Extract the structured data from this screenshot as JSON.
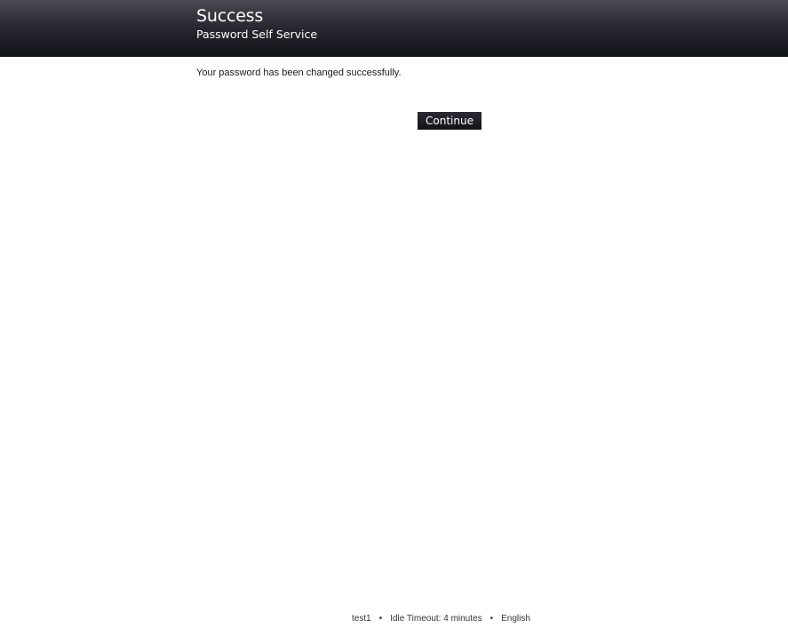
{
  "header": {
    "title": "Success",
    "subtitle": "Password Self Service"
  },
  "main": {
    "message": "Your password has been changed successfully.",
    "continue_label": "Continue"
  },
  "footer": {
    "username": "test1",
    "separator": "•",
    "idle_timeout": "Idle Timeout: 4 minutes",
    "language": "English"
  },
  "colors": {
    "header_bg_top": "#4a4a52",
    "header_bg_bottom": "#111118",
    "button_bg": "#121218",
    "text": "#1a1a1a"
  }
}
